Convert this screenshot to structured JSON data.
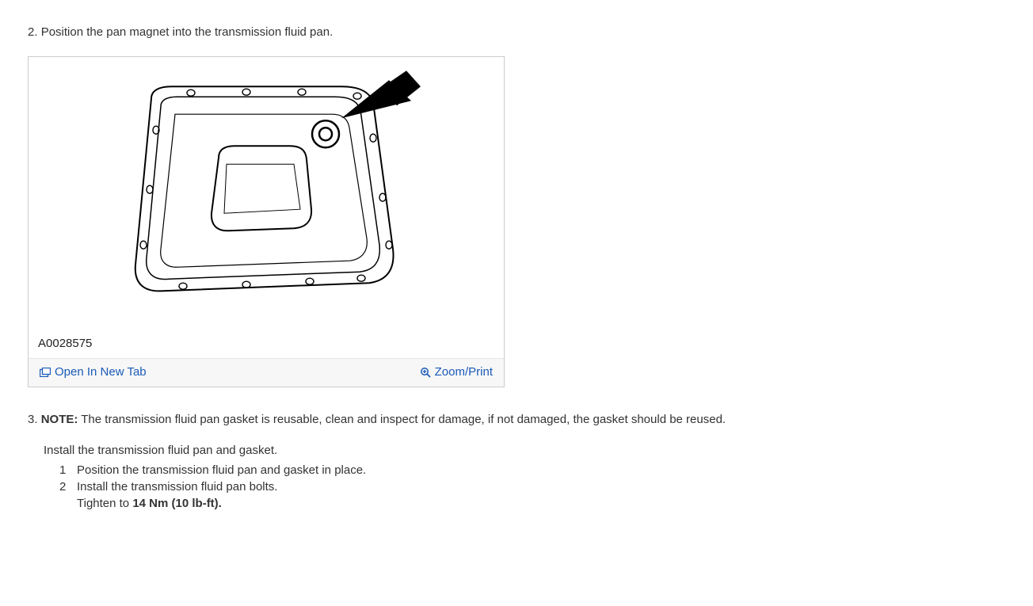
{
  "step2": {
    "number": "2.",
    "text": "Position the pan magnet into the transmission fluid pan."
  },
  "figure": {
    "label": "A0028575",
    "open_tab": "Open In New Tab",
    "zoom": "Zoom/Print"
  },
  "step3": {
    "number": "3.",
    "note_label": "NOTE:",
    "note_text": "The transmission fluid pan gasket is reusable, clean and inspect for damage, if not damaged, the gasket should be reused.",
    "instruction": "Install the transmission fluid pan and gasket.",
    "sub1_num": "1",
    "sub1_text": "Position the transmission fluid pan and gasket in place.",
    "sub2_num": "2",
    "sub2_text": "Install the transmission fluid pan bolts.",
    "tighten_prefix": "Tighten to ",
    "torque": "14 Nm (10 lb-ft)."
  }
}
